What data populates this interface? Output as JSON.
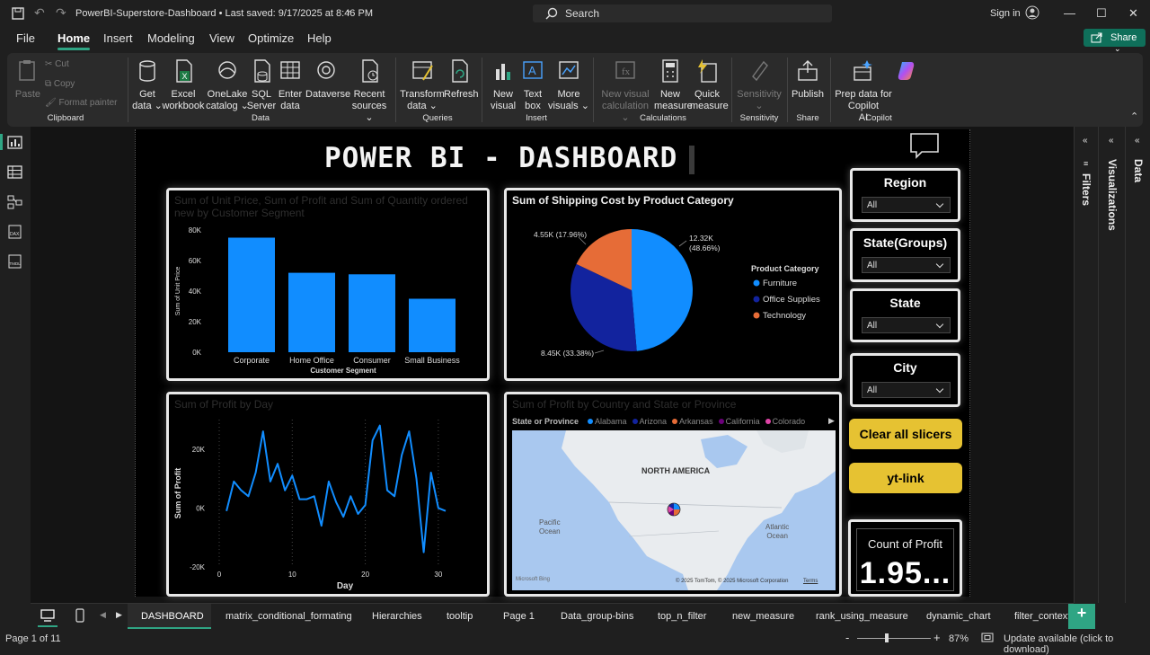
{
  "titlebar": {
    "title": "PowerBI-Superstore-Dashboard • Last saved: 9/17/2025 at 8:46 PM",
    "search_placeholder": "Search",
    "signin": "Sign in"
  },
  "menu": {
    "items": [
      "File",
      "Home",
      "Insert",
      "Modeling",
      "View",
      "Optimize",
      "Help"
    ],
    "active": "Home",
    "share": "Share"
  },
  "ribbon": {
    "clipboard": {
      "paste": "Paste",
      "cut": "Cut",
      "copy": "Copy",
      "format_painter": "Format painter",
      "group": "Clipboard"
    },
    "data": {
      "get_data": [
        "Get",
        "data ⌄"
      ],
      "excel": [
        "Excel",
        "workbook"
      ],
      "onelake": [
        "OneLake",
        "catalog ⌄"
      ],
      "sql": [
        "SQL",
        "Server"
      ],
      "enter": [
        "Enter",
        "data"
      ],
      "dataverse": [
        "Dataverse",
        ""
      ],
      "recent": [
        "Recent",
        "sources ⌄"
      ],
      "group": "Data"
    },
    "queries": {
      "transform": [
        "Transform",
        "data ⌄"
      ],
      "refresh": [
        "Refresh",
        ""
      ],
      "group": "Queries"
    },
    "insert": {
      "new_visual": [
        "New",
        "visual"
      ],
      "text_box": [
        "Text",
        "box"
      ],
      "more_visuals": [
        "More",
        "visuals ⌄"
      ],
      "group": "Insert"
    },
    "calculations": {
      "new_visual_calc": [
        "New visual",
        "calculation ⌄"
      ],
      "new_measure": [
        "New",
        "measure"
      ],
      "quick_measure": [
        "Quick",
        "measure"
      ],
      "group": "Calculations"
    },
    "sensitivity": {
      "label": [
        "Sensitivity",
        "⌄"
      ],
      "group": "Sensitivity"
    },
    "share": {
      "publish": [
        "Publish",
        ""
      ],
      "group": "Share"
    },
    "copilot": {
      "prep": [
        "Prep data for Copilot",
        "AI"
      ],
      "group": "Copilot"
    }
  },
  "report": {
    "title": "POWER BI - DASHBOARD",
    "bar_title": "Sum of Unit Price, Sum of Profit and Sum of Quantity ordered new by Customer Segment",
    "pie_title": "Sum of Shipping Cost by Product Category",
    "line_title": "Sum of Profit by Day",
    "map_title": "Sum of Profit by Country and State or Province",
    "map_legend_title": "State or Province",
    "map_legend": [
      {
        "name": "Alabama",
        "color": "#118DFF"
      },
      {
        "name": "Arizona",
        "color": "#12239E"
      },
      {
        "name": "Arkansas",
        "color": "#E66C37"
      },
      {
        "name": "California",
        "color": "#6B007B"
      },
      {
        "name": "Colorado",
        "color": "#E044A7"
      }
    ],
    "map_labels": {
      "na": "NORTH AMERICA",
      "pacific": "Pacific\nOcean",
      "atlantic": "Atlantic\nOcean",
      "copyright": "© 2025 TomTom, © 2025 Microsoft Corporation",
      "terms": "Terms",
      "bing": "Microsoft Bing"
    },
    "slicers": [
      {
        "label": "Region",
        "value": "All"
      },
      {
        "label": "State(Groups)",
        "value": "All"
      },
      {
        "label": "State",
        "value": "All"
      },
      {
        "label": "City",
        "value": "All"
      }
    ],
    "buttons": {
      "clear": "Clear all slicers",
      "yt": "yt-link"
    },
    "kpi": {
      "label": "Count of Profit",
      "value": "1.95..."
    }
  },
  "chart_data": [
    {
      "type": "bar",
      "title": "Sum of Unit Price, Sum of Profit and Sum of Quantity ordered new by Customer Segment",
      "categories": [
        "Corporate",
        "Home Office",
        "Consumer",
        "Small Business"
      ],
      "values": [
        75000,
        52000,
        51000,
        35000
      ],
      "xlabel": "Customer Segment",
      "ylabel": "Sum of Unit Price",
      "ylim": [
        0,
        80000
      ],
      "yticks": [
        "0K",
        "20K",
        "40K",
        "60K",
        "80K"
      ],
      "color": "#118DFF"
    },
    {
      "type": "pie",
      "title": "Sum of Shipping Cost by Product Category",
      "legend_title": "Product Category",
      "categories": [
        "Furniture",
        "Office Supplies",
        "Technology"
      ],
      "values": [
        12320,
        8450,
        4550
      ],
      "labels": [
        "12.32K (48.66%)",
        "8.45K (33.38%)",
        "4.55K (17.96%)"
      ],
      "colors": [
        "#118DFF",
        "#12239E",
        "#E66C37"
      ]
    },
    {
      "type": "line",
      "title": "Sum of Profit by Day",
      "xlabel": "Day",
      "ylabel": "Sum of Profit",
      "x": [
        1,
        2,
        3,
        4,
        5,
        6,
        7,
        8,
        9,
        10,
        11,
        12,
        13,
        14,
        15,
        16,
        17,
        18,
        19,
        20,
        21,
        22,
        23,
        24,
        25,
        26,
        27,
        28,
        29,
        30,
        31
      ],
      "y": [
        -1000,
        9000,
        6000,
        4000,
        12000,
        26000,
        9000,
        15000,
        6000,
        11000,
        3000,
        3000,
        4000,
        -6000,
        9000,
        2000,
        -3000,
        4000,
        -2000,
        1000,
        23000,
        28000,
        6000,
        4000,
        18000,
        26000,
        10000,
        -15000,
        12000,
        0,
        -1000
      ],
      "xticks": [
        0,
        10,
        20,
        30
      ],
      "yticks": [
        "-20K",
        "0K",
        "20K"
      ],
      "ylim": [
        -20000,
        30000
      ],
      "color": "#118DFF"
    }
  ],
  "tabs": [
    "DASHBOARD",
    "matrix_conditional_formating",
    "Hierarchies",
    "tooltip",
    "Page 1",
    "Data_group-bins",
    "top_n_filter",
    "new_measure",
    "rank_using_measure",
    "dynamic_chart",
    "filter_context"
  ],
  "active_tab": "DASHBOARD",
  "status": {
    "page": "Page 1 of 11",
    "zoom": "87%",
    "update": "Update available (click to download)"
  },
  "panes": {
    "filters": "Filters",
    "visualizations": "Visualizations",
    "data": "Data"
  }
}
